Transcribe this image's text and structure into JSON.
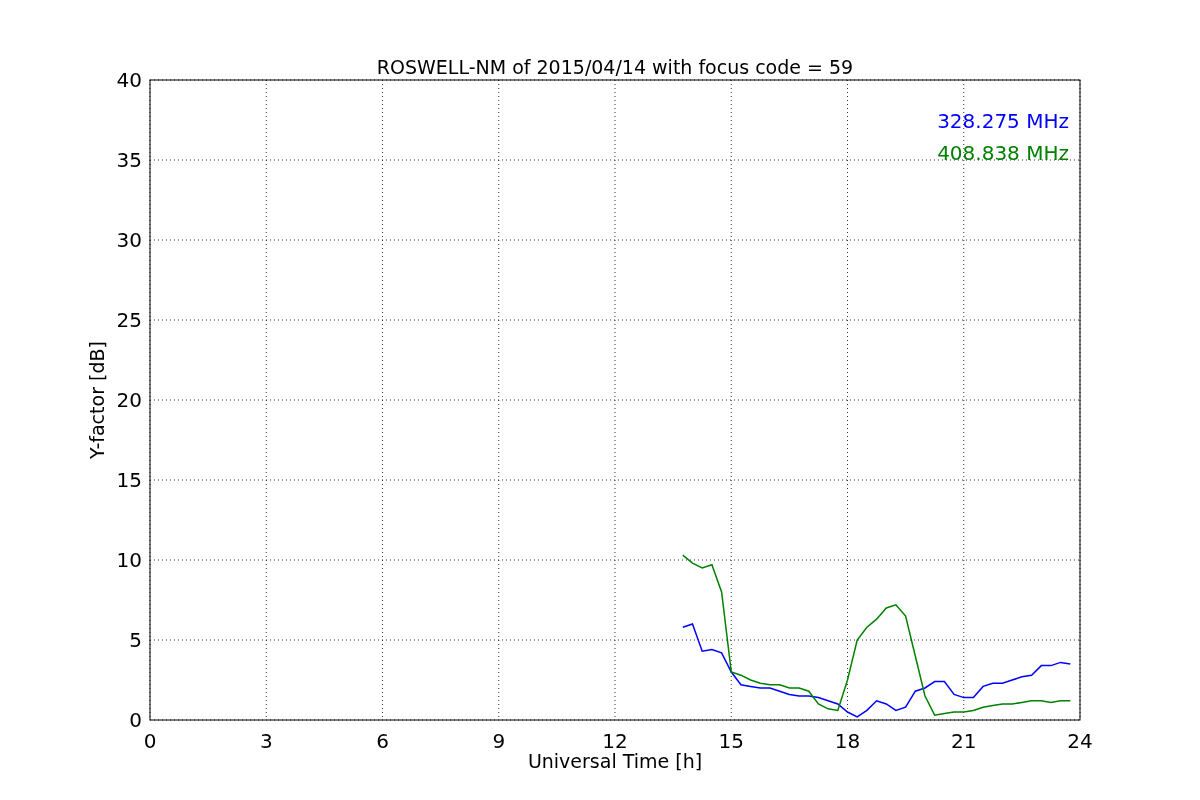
{
  "chart_data": {
    "type": "line",
    "title": "ROSWELL-NM of 2015/04/14 with focus code = 59",
    "xlabel": "Universal Time [h]",
    "ylabel": "Y-factor [dB]",
    "x": [
      13.75,
      14,
      14.25,
      14.5,
      14.75,
      15,
      15.25,
      15.5,
      15.75,
      16,
      16.25,
      16.5,
      16.75,
      17,
      17.25,
      17.5,
      17.75,
      18,
      18.25,
      18.5,
      18.75,
      19,
      19.25,
      19.5,
      19.75,
      20,
      20.25,
      20.5,
      20.75,
      21,
      21.25,
      21.5,
      21.75,
      22,
      22.25,
      22.5,
      22.75,
      23,
      23.25,
      23.5,
      23.75
    ],
    "series": [
      {
        "name": "328.275 MHz",
        "color": "#0000ff",
        "values": [
          5.8,
          6.0,
          4.3,
          4.4,
          4.2,
          3.0,
          2.2,
          2.1,
          2.0,
          2.0,
          1.8,
          1.6,
          1.5,
          1.5,
          1.4,
          1.2,
          1.0,
          0.5,
          0.2,
          0.6,
          1.2,
          1.0,
          0.6,
          0.8,
          1.8,
          2.0,
          2.4,
          2.4,
          1.6,
          1.4,
          1.4,
          2.1,
          2.3,
          2.3,
          2.5,
          2.7,
          2.8,
          3.4,
          3.4,
          3.6,
          3.5
        ]
      },
      {
        "name": "408.838 MHz",
        "color": "#008000",
        "values": [
          10.3,
          9.8,
          9.5,
          9.7,
          8.0,
          3.0,
          2.8,
          2.5,
          2.3,
          2.2,
          2.2,
          2.0,
          2.0,
          1.8,
          1.0,
          0.7,
          0.6,
          2.5,
          5.0,
          5.8,
          6.3,
          7.0,
          7.2,
          6.5,
          4.0,
          1.5,
          0.3,
          0.4,
          0.5,
          0.5,
          0.6,
          0.8,
          0.9,
          1.0,
          1.0,
          1.1,
          1.2,
          1.2,
          1.1,
          1.2,
          1.2
        ]
      }
    ],
    "grid": true,
    "xlim": [
      0,
      24
    ],
    "ylim": [
      0,
      40
    ],
    "xticks": [
      0,
      3,
      6,
      9,
      12,
      15,
      18,
      21,
      24
    ],
    "yticks": [
      0,
      5,
      10,
      15,
      20,
      25,
      30,
      35,
      40
    ]
  }
}
